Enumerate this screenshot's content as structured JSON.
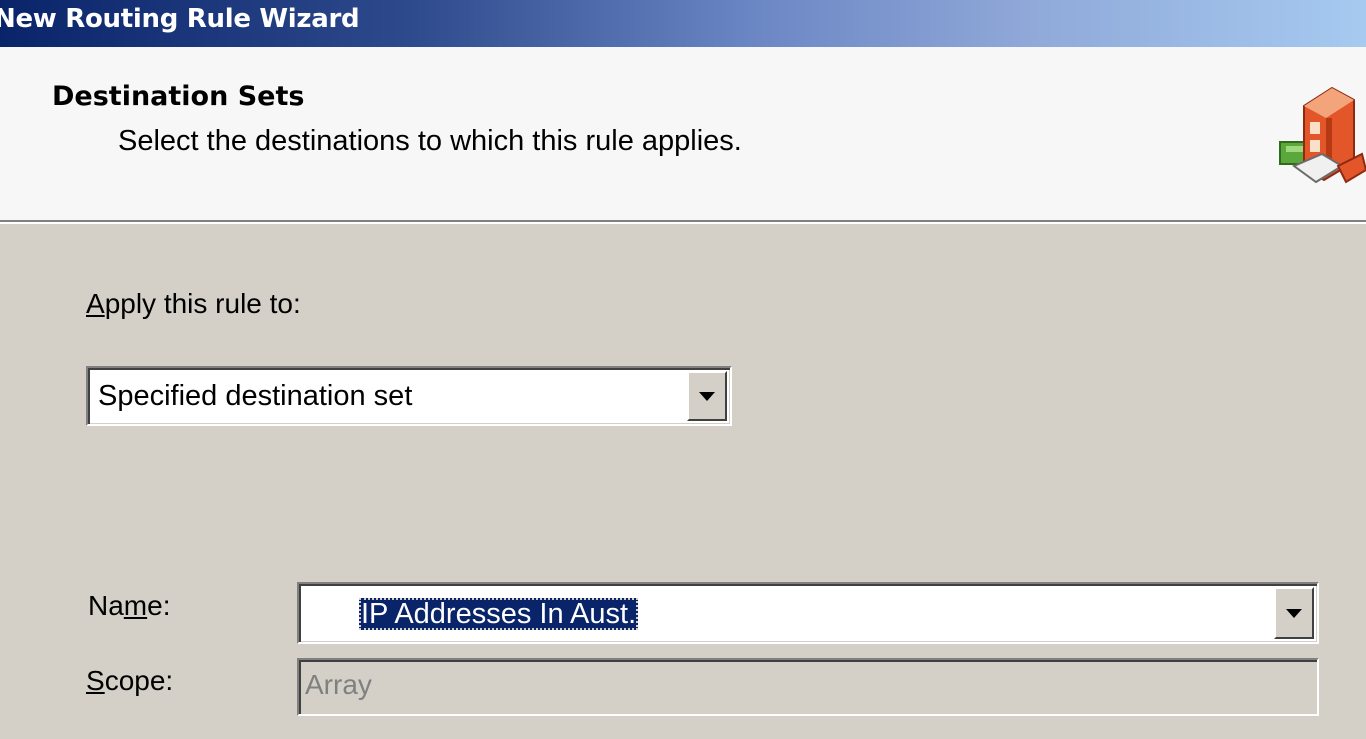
{
  "window": {
    "title": "New Routing Rule Wizard"
  },
  "header": {
    "title": "Destination Sets",
    "subtitle": "Select the destinations to which this rule applies.",
    "icon": "routing-wizard-icon"
  },
  "apply_to": {
    "label_accel": "A",
    "label_rest": "pply this rule to:",
    "selected": "Specified destination set"
  },
  "name_field": {
    "label_pre": "Na",
    "label_accel": "m",
    "label_post": "e:",
    "selected": "IP Addresses In Aust."
  },
  "scope_field": {
    "label_accel": "S",
    "label_rest": "cope:",
    "value": "Array"
  },
  "colors": {
    "title_gradient_start": "#0a246a",
    "title_gradient_end": "#a6caf0",
    "selection": "#0a246a",
    "dialog_bg": "#d4d0c8"
  }
}
